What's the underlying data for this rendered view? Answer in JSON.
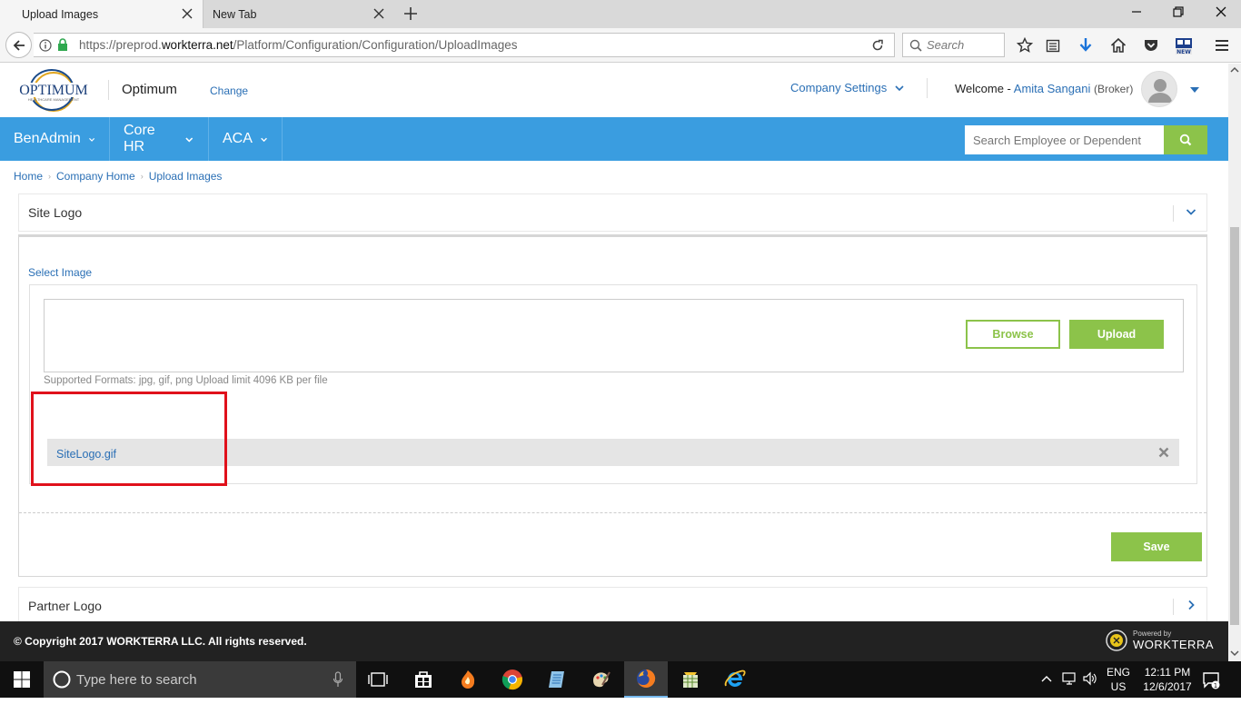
{
  "browser": {
    "tabs": [
      {
        "title": "Upload Images",
        "active": true
      },
      {
        "title": "New Tab",
        "active": false
      }
    ],
    "url": {
      "prefix": "https://preprod.",
      "domain": "workterra.net",
      "path": "/Platform/Configuration/Configuration/UploadImages"
    },
    "search_placeholder": "Search"
  },
  "header": {
    "logo_text": "OPTIMUM",
    "logo_subtext": "HEALTHCARE MANAGEMENT",
    "company": "Optimum",
    "change_link": "Change",
    "company_settings": "Company Settings",
    "welcome_label": "Welcome -",
    "user_name": "Amita Sangani",
    "user_role": "(Broker)"
  },
  "menu": {
    "items": [
      "BenAdmin",
      "Core HR",
      "ACA"
    ],
    "search_placeholder": "Search Employee or Dependent"
  },
  "breadcrumb": [
    "Home",
    "Company Home",
    "Upload Images"
  ],
  "site_logo_panel": {
    "title": "Site Logo",
    "select_label": "Select Image",
    "browse_label": "Browse",
    "upload_label": "Upload",
    "formats_text": "Supported Formats: jpg, gif, png Upload limit 4096 KB per file",
    "file_name": "SiteLogo.gif",
    "save_label": "Save"
  },
  "partner_logo_panel": {
    "title": "Partner Logo"
  },
  "footer": {
    "copyright": "© Copyright 2017 WORKTERRA LLC. All rights reserved.",
    "powered_by": "Powered by",
    "brand": "WORKTERRA"
  },
  "taskbar": {
    "search_placeholder": "Type here to search",
    "lang_top": "ENG",
    "lang_bottom": "US",
    "time": "12:11 PM",
    "date": "12/6/2017",
    "notification_count": "1"
  },
  "colors": {
    "accent_blue": "#3a9de0",
    "green": "#8cc34a",
    "link": "#2a6fb5",
    "highlight_red": "#e0111b"
  }
}
